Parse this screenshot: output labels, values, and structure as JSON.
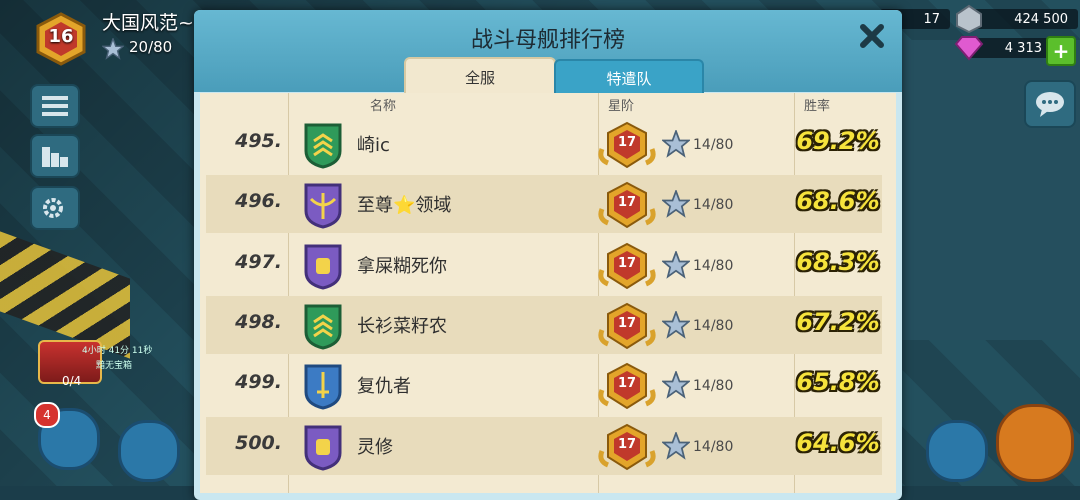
{
  "player": {
    "level": "16",
    "name": "大国风范~",
    "stars": "20/80"
  },
  "hud": {
    "chest_timer": "4小时 41分 11秒",
    "chest_label": "黯无宝箱",
    "chest_count": "0/4",
    "notification_count": "4",
    "top_resource_partial": "17",
    "resource_amount": "424 500",
    "diamonds": "4 313",
    "plus_label": "+"
  },
  "modal": {
    "title": "战斗母舰排行榜",
    "tabs": [
      {
        "label": "全服",
        "active": true
      },
      {
        "label": "特遣队",
        "active": false
      }
    ],
    "columns": {
      "name": "名称",
      "tier": "星阶",
      "winrate": "胜率"
    },
    "rows": [
      {
        "rank": "495.",
        "name": "崎ic",
        "emblem": "green-sergeant-chevrons-icon",
        "tier": "17",
        "stars": "14/80",
        "winrate": "69.2%"
      },
      {
        "rank": "496.",
        "name": "至尊⭐领域",
        "emblem": "purple-winged-sword-icon",
        "tier": "17",
        "stars": "14/80",
        "winrate": "68.6%"
      },
      {
        "rank": "497.",
        "name": "拿屎糊死你",
        "emblem": "purple-fist-icon",
        "tier": "17",
        "stars": "14/80",
        "winrate": "68.3%"
      },
      {
        "rank": "498.",
        "name": "长衫菜籽农",
        "emblem": "green-sergeant-chevrons-icon",
        "tier": "17",
        "stars": "14/80",
        "winrate": "67.2%"
      },
      {
        "rank": "499.",
        "name": "复仇者",
        "emblem": "blue-sword-laurel-icon",
        "tier": "17",
        "stars": "14/80",
        "winrate": "65.8%"
      },
      {
        "rank": "500.",
        "name": "灵修",
        "emblem": "purple-fist-icon",
        "tier": "17",
        "stars": "14/80",
        "winrate": "64.6%"
      }
    ]
  },
  "colors": {
    "winrate": "#f6e33c",
    "header": "#4a9dba",
    "table": "#f3ead2",
    "badge": "#c0392b"
  }
}
